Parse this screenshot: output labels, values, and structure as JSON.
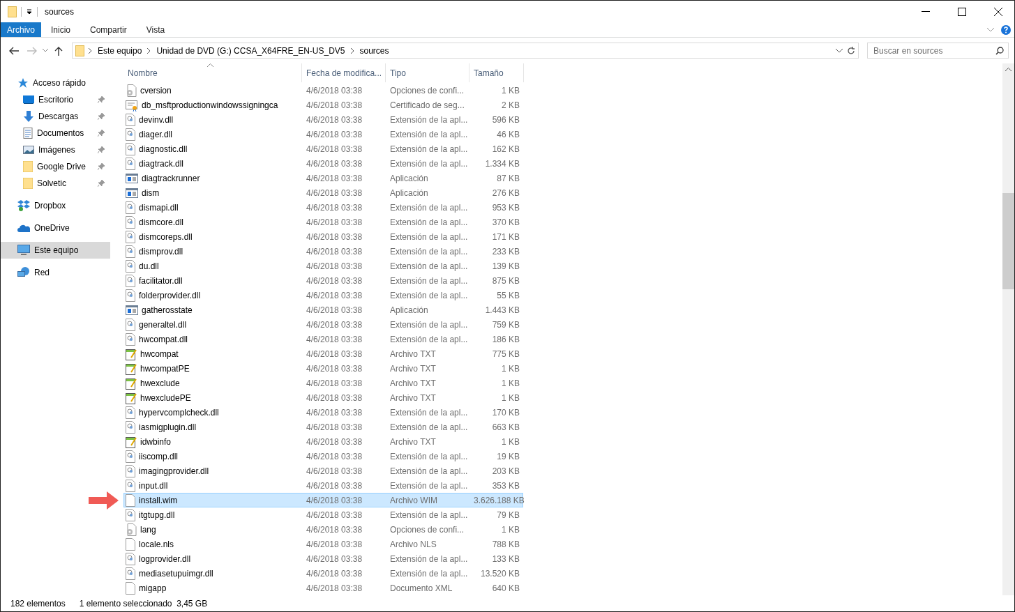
{
  "window": {
    "title": "sources"
  },
  "ribbon_tabs": [
    {
      "label": "Archivo",
      "kind": "file"
    },
    {
      "label": "Inicio",
      "kind": "tab"
    },
    {
      "label": "Compartir",
      "kind": "tab"
    },
    {
      "label": "Vista",
      "kind": "tab"
    }
  ],
  "navigation": {
    "back_disabled": false,
    "forward_disabled": true
  },
  "breadcrumbs": [
    "Este equipo",
    "Unidad de DVD (G:) CCSA_X64FRE_EN-US_DV5",
    "sources"
  ],
  "search": {
    "placeholder": "Buscar en sources"
  },
  "sidebar": {
    "items": [
      {
        "label": "Acceso rápido",
        "kind": "star",
        "selected": false,
        "children": [
          {
            "label": "Escritorio",
            "kind": "desktop",
            "pinned": true,
            "selected": false
          },
          {
            "label": "Descargas",
            "kind": "download",
            "pinned": true,
            "selected": false
          },
          {
            "label": "Documentos",
            "kind": "document",
            "pinned": true,
            "selected": false
          },
          {
            "label": "Imágenes",
            "kind": "image",
            "pinned": true,
            "selected": false
          },
          {
            "label": "Google Drive",
            "kind": "folder",
            "pinned": true,
            "selected": false
          },
          {
            "label": "Solvetic",
            "kind": "folder",
            "pinned": true,
            "selected": false
          }
        ]
      },
      {
        "label": "Dropbox",
        "kind": "dropbox",
        "selected": false
      },
      {
        "label": "OneDrive",
        "kind": "cloud",
        "selected": false
      },
      {
        "label": "Este equipo",
        "kind": "pc",
        "selected": true
      },
      {
        "label": "Red",
        "kind": "network",
        "selected": false
      }
    ]
  },
  "table": {
    "columns": [
      {
        "label": "Nombre",
        "sorted": true
      },
      {
        "label": "Fecha de modifica...",
        "sorted": false
      },
      {
        "label": "Tipo",
        "sorted": false
      },
      {
        "label": "Tamaño",
        "sorted": false
      }
    ],
    "rows": [
      {
        "name": "cversion",
        "kind": "config",
        "date": "4/6/2018 03:38",
        "type": "Opciones de confi...",
        "size": "1 KB",
        "selected": false
      },
      {
        "name": "db_msftproductionwindowssigningca",
        "kind": "cert",
        "date": "4/6/2018 03:38",
        "type": "Certificado de seg...",
        "size": "2 KB",
        "selected": false
      },
      {
        "name": "devinv.dll",
        "kind": "dll",
        "date": "4/6/2018 03:38",
        "type": "Extensión de la apl...",
        "size": "596 KB",
        "selected": false
      },
      {
        "name": "diager.dll",
        "kind": "dll",
        "date": "4/6/2018 03:38",
        "type": "Extensión de la apl...",
        "size": "46 KB",
        "selected": false
      },
      {
        "name": "diagnostic.dll",
        "kind": "dll",
        "date": "4/6/2018 03:38",
        "type": "Extensión de la apl...",
        "size": "162 KB",
        "selected": false
      },
      {
        "name": "diagtrack.dll",
        "kind": "dll",
        "date": "4/6/2018 03:38",
        "type": "Extensión de la apl...",
        "size": "1.334 KB",
        "selected": false
      },
      {
        "name": "diagtrackrunner",
        "kind": "app",
        "date": "4/6/2018 03:38",
        "type": "Aplicación",
        "size": "87 KB",
        "selected": false
      },
      {
        "name": "dism",
        "kind": "app",
        "date": "4/6/2018 03:38",
        "type": "Aplicación",
        "size": "276 KB",
        "selected": false
      },
      {
        "name": "dismapi.dll",
        "kind": "dll",
        "date": "4/6/2018 03:38",
        "type": "Extensión de la apl...",
        "size": "953 KB",
        "selected": false
      },
      {
        "name": "dismcore.dll",
        "kind": "dll",
        "date": "4/6/2018 03:38",
        "type": "Extensión de la apl...",
        "size": "370 KB",
        "selected": false
      },
      {
        "name": "dismcoreps.dll",
        "kind": "dll",
        "date": "4/6/2018 03:38",
        "type": "Extensión de la apl...",
        "size": "171 KB",
        "selected": false
      },
      {
        "name": "dismprov.dll",
        "kind": "dll",
        "date": "4/6/2018 03:38",
        "type": "Extensión de la apl...",
        "size": "233 KB",
        "selected": false
      },
      {
        "name": "du.dll",
        "kind": "dll",
        "date": "4/6/2018 03:38",
        "type": "Extensión de la apl...",
        "size": "139 KB",
        "selected": false
      },
      {
        "name": "facilitator.dll",
        "kind": "dll",
        "date": "4/6/2018 03:38",
        "type": "Extensión de la apl...",
        "size": "875 KB",
        "selected": false
      },
      {
        "name": "folderprovider.dll",
        "kind": "dll",
        "date": "4/6/2018 03:38",
        "type": "Extensión de la apl...",
        "size": "55 KB",
        "selected": false
      },
      {
        "name": "gatherosstate",
        "kind": "app",
        "date": "4/6/2018 03:38",
        "type": "Aplicación",
        "size": "1.443 KB",
        "selected": false
      },
      {
        "name": "generaltel.dll",
        "kind": "dll",
        "date": "4/6/2018 03:38",
        "type": "Extensión de la apl...",
        "size": "759 KB",
        "selected": false
      },
      {
        "name": "hwcompat.dll",
        "kind": "dll",
        "date": "4/6/2018 03:38",
        "type": "Extensión de la apl...",
        "size": "186 KB",
        "selected": false
      },
      {
        "name": "hwcompat",
        "kind": "txt",
        "date": "4/6/2018 03:38",
        "type": "Archivo TXT",
        "size": "775 KB",
        "selected": false
      },
      {
        "name": "hwcompatPE",
        "kind": "txt",
        "date": "4/6/2018 03:38",
        "type": "Archivo TXT",
        "size": "1 KB",
        "selected": false
      },
      {
        "name": "hwexclude",
        "kind": "txt",
        "date": "4/6/2018 03:38",
        "type": "Archivo TXT",
        "size": "1 KB",
        "selected": false
      },
      {
        "name": "hwexcludePE",
        "kind": "txt",
        "date": "4/6/2018 03:38",
        "type": "Archivo TXT",
        "size": "1 KB",
        "selected": false
      },
      {
        "name": "hypervcomplcheck.dll",
        "kind": "dll",
        "date": "4/6/2018 03:38",
        "type": "Extensión de la apl...",
        "size": "170 KB",
        "selected": false
      },
      {
        "name": "iasmigplugin.dll",
        "kind": "dll",
        "date": "4/6/2018 03:38",
        "type": "Extensión de la apl...",
        "size": "663 KB",
        "selected": false
      },
      {
        "name": "idwbinfo",
        "kind": "txt",
        "date": "4/6/2018 03:38",
        "type": "Archivo TXT",
        "size": "1 KB",
        "selected": false
      },
      {
        "name": "iiscomp.dll",
        "kind": "dll",
        "date": "4/6/2018 03:38",
        "type": "Extensión de la apl...",
        "size": "19 KB",
        "selected": false
      },
      {
        "name": "imagingprovider.dll",
        "kind": "dll",
        "date": "4/6/2018 03:38",
        "type": "Extensión de la apl...",
        "size": "203 KB",
        "selected": false
      },
      {
        "name": "input.dll",
        "kind": "dll",
        "date": "4/6/2018 03:38",
        "type": "Extensión de la apl...",
        "size": "353 KB",
        "selected": false
      },
      {
        "name": "install.wim",
        "kind": "blank",
        "date": "4/6/2018 03:38",
        "type": "Archivo WIM",
        "size": "3.626.188 KB",
        "selected": true,
        "pointed": true
      },
      {
        "name": "itgtupg.dll",
        "kind": "dll",
        "date": "4/6/2018 03:38",
        "type": "Extensión de la apl...",
        "size": "79 KB",
        "selected": false
      },
      {
        "name": "lang",
        "kind": "config",
        "date": "4/6/2018 03:38",
        "type": "Opciones de confi...",
        "size": "1 KB",
        "selected": false
      },
      {
        "name": "locale.nls",
        "kind": "blank",
        "date": "4/6/2018 03:38",
        "type": "Archivo NLS",
        "size": "788 KB",
        "selected": false
      },
      {
        "name": "logprovider.dll",
        "kind": "dll",
        "date": "4/6/2018 03:38",
        "type": "Extensión de la apl...",
        "size": "133 KB",
        "selected": false
      },
      {
        "name": "mediasetupuimgr.dll",
        "kind": "dll",
        "date": "4/6/2018 03:38",
        "type": "Extensión de la apl...",
        "size": "13.520 KB",
        "selected": false
      },
      {
        "name": "migapp",
        "kind": "blank",
        "date": "4/6/2018 03:38",
        "type": "Documento XML",
        "size": "640 KB",
        "selected": false
      }
    ]
  },
  "status_bar": {
    "count": "182 elementos",
    "selection": "1 elemento seleccionado  3,45 GB"
  }
}
